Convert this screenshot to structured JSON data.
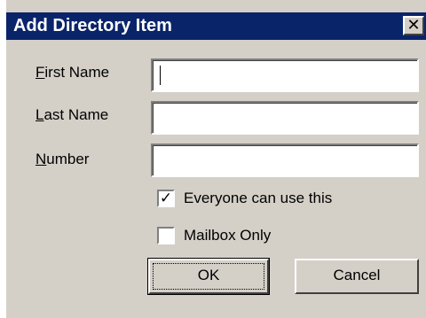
{
  "window": {
    "title": "Add Directory Item",
    "close_glyph": "✕"
  },
  "form": {
    "first_name": {
      "label_mnemonic": "F",
      "label_rest": "irst Name",
      "value": ""
    },
    "last_name": {
      "label_mnemonic": "L",
      "label_rest": "ast Name",
      "value": ""
    },
    "number": {
      "label_mnemonic": "N",
      "label_rest": "umber",
      "value": ""
    },
    "everyone_can_use": {
      "label": "Everyone can use this",
      "checked": true,
      "check_glyph": "✓"
    },
    "mailbox_only": {
      "label": "Mailbox Only",
      "checked": false
    }
  },
  "buttons": {
    "ok_label": "OK",
    "cancel_label": "Cancel"
  },
  "colors": {
    "titlebar": "#0a246a",
    "dialog_bg": "#d4d0c8"
  }
}
